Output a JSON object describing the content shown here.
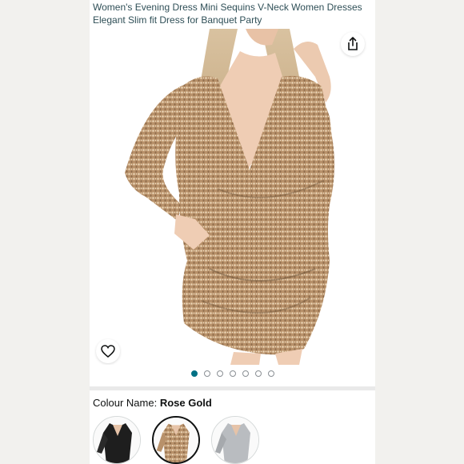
{
  "product": {
    "title_line1": "Women's Evening Dress Mini Sequins V-Neck Women Dresses",
    "title_line2": "Elegant Slim fit Dress for Banquet Party"
  },
  "gallery": {
    "image_count": 7,
    "active_index": 0
  },
  "variation": {
    "label": "Colour Name:",
    "selected": "Rose Gold",
    "swatches": [
      {
        "color": "black"
      },
      {
        "color": "rose-gold"
      },
      {
        "color": "silver"
      }
    ]
  },
  "colors": {
    "accent": "#007185",
    "title_text": "#2f4f57",
    "sequin_gold": "#c9a37c"
  }
}
